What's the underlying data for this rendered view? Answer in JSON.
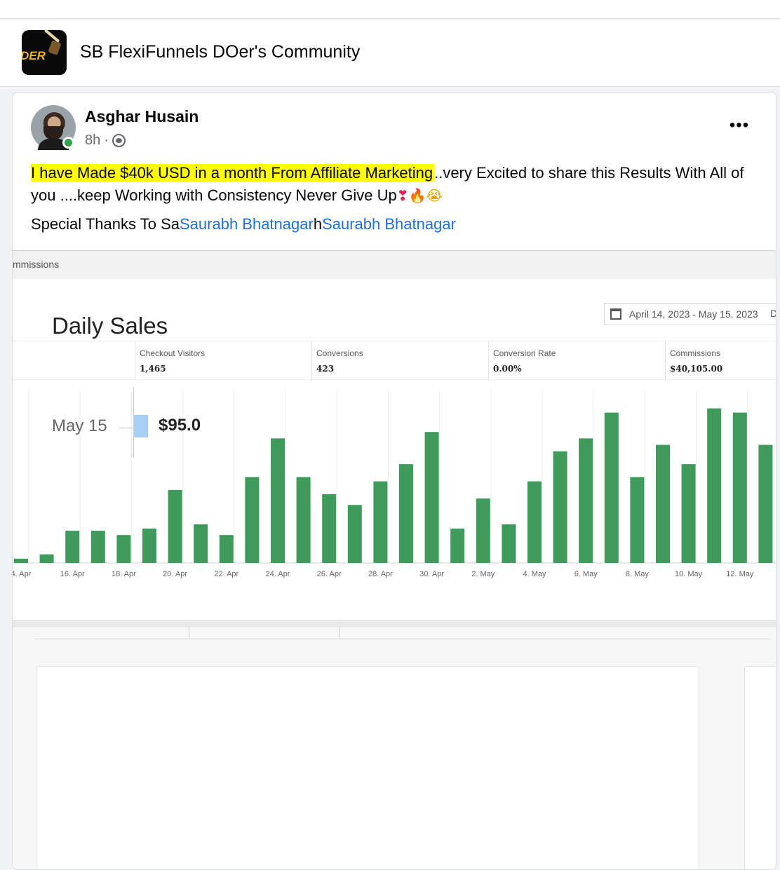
{
  "group": {
    "logo_text": "DER",
    "name": "SB FlexiFunnels DOer's Community"
  },
  "post": {
    "author": "Asghar Husain",
    "time": "8h",
    "separator": "·",
    "more_label": "•••",
    "text_highlight": "I have Made $40k USD in a month From Affiliate Marketing",
    "text_rest": "..very Excited to share this Results With All of you ....keep Working with Consistency Never Give Up",
    "emojis": {
      "heart": "❣",
      "fire": "🔥",
      "face": "😭"
    },
    "thanks_prefix": "Special Thanks To Sa",
    "mention_1": "Saurabh Bhatnagar",
    "thanks_mid": "h",
    "mention_2": "Saurabh Bhatnagar"
  },
  "screenshot": {
    "crumb": "mmissions",
    "date_range": "April 14, 2023 - May 15, 2023",
    "date_range_extra": "D",
    "stats": [
      {
        "label": "Checkout Visitors",
        "value": "1,465"
      },
      {
        "label": "Conversions",
        "value": "423"
      },
      {
        "label": "Conversion Rate",
        "value": "0.00%"
      },
      {
        "label": "Commissions",
        "value": "$40,105.00"
      }
    ],
    "daily_sales": {
      "title": "Daily Sales",
      "date": "May 15",
      "value": "$95.0"
    }
  },
  "chart_data": {
    "type": "bar",
    "categories": [
      "14. Apr",
      "15. Apr",
      "16. Apr",
      "17. Apr",
      "18. Apr",
      "19. Apr",
      "20. Apr",
      "21. Apr",
      "22. Apr",
      "23. Apr",
      "24. Apr",
      "25. Apr",
      "26. Apr",
      "27. Apr",
      "28. Apr",
      "29. Apr",
      "30. Apr",
      "1. May",
      "2. May",
      "3. May",
      "4. May",
      "5. May",
      "6. May",
      "7. May",
      "8. May",
      "9. May",
      "10. May",
      "11. May",
      "12. May",
      "13. May"
    ],
    "tick_labels": [
      "4. Apr",
      "16. Apr",
      "18. Apr",
      "20. Apr",
      "22. Apr",
      "24. Apr",
      "26. Apr",
      "28. Apr",
      "30. Apr",
      "2. May",
      "4. May",
      "6. May",
      "8. May",
      "10. May",
      "12. May"
    ],
    "values": [
      1,
      2,
      7.5,
      7.5,
      6.5,
      8,
      17,
      9,
      6.5,
      20,
      29,
      20,
      16,
      13.5,
      19,
      23,
      30.5,
      8,
      15,
      9,
      19,
      26,
      29,
      35,
      20,
      27.5,
      23,
      36,
      35,
      27.5
    ],
    "color": "#3e9b5b",
    "ylim": [
      0,
      40
    ],
    "grid": true
  }
}
